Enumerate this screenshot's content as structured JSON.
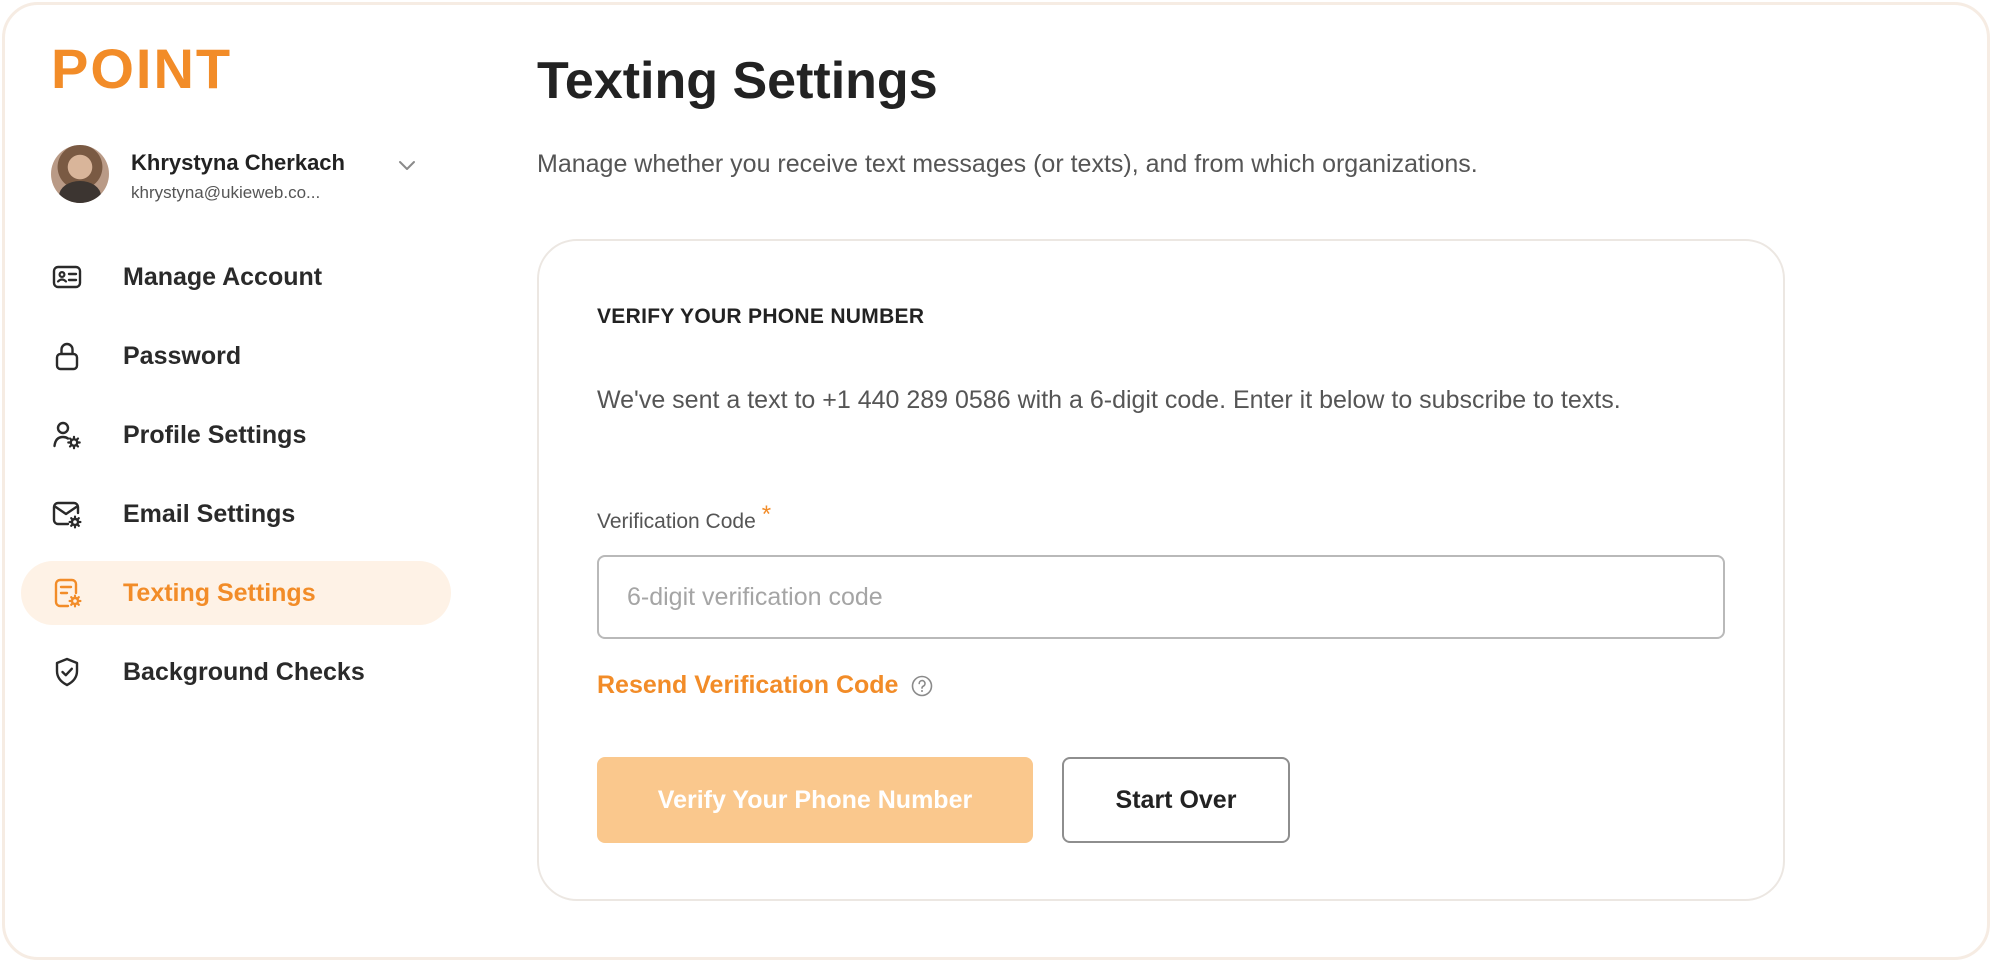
{
  "brand": {
    "logo_text": "POINT",
    "accent_color": "#f28c28"
  },
  "user": {
    "name": "Khrystyna Cherkach",
    "email": "khrystyna@ukieweb.co..."
  },
  "sidebar": {
    "items": [
      {
        "label": "Manage Account",
        "icon": "id-card-icon",
        "active": false
      },
      {
        "label": "Password",
        "icon": "lock-icon",
        "active": false
      },
      {
        "label": "Profile Settings",
        "icon": "user-gear-icon",
        "active": false
      },
      {
        "label": "Email Settings",
        "icon": "mail-gear-icon",
        "active": false
      },
      {
        "label": "Texting Settings",
        "icon": "phone-message-icon",
        "active": true
      },
      {
        "label": "Background Checks",
        "icon": "shield-check-icon",
        "active": false
      }
    ]
  },
  "main": {
    "title": "Texting Settings",
    "subtitle": "Manage whether you receive text messages (or texts), and from which organizations."
  },
  "verify_card": {
    "heading": "VERIFY YOUR PHONE NUMBER",
    "message": "We've sent a text to +1 440 289 0586 with a 6-digit code. Enter it below to subscribe to texts.",
    "field_label": "Verification Code",
    "required_marker": "*",
    "input_placeholder": "6-digit verification code",
    "input_value": "",
    "resend_label": "Resend Verification Code",
    "verify_button": "Verify Your Phone Number",
    "start_over_button": "Start Over"
  }
}
